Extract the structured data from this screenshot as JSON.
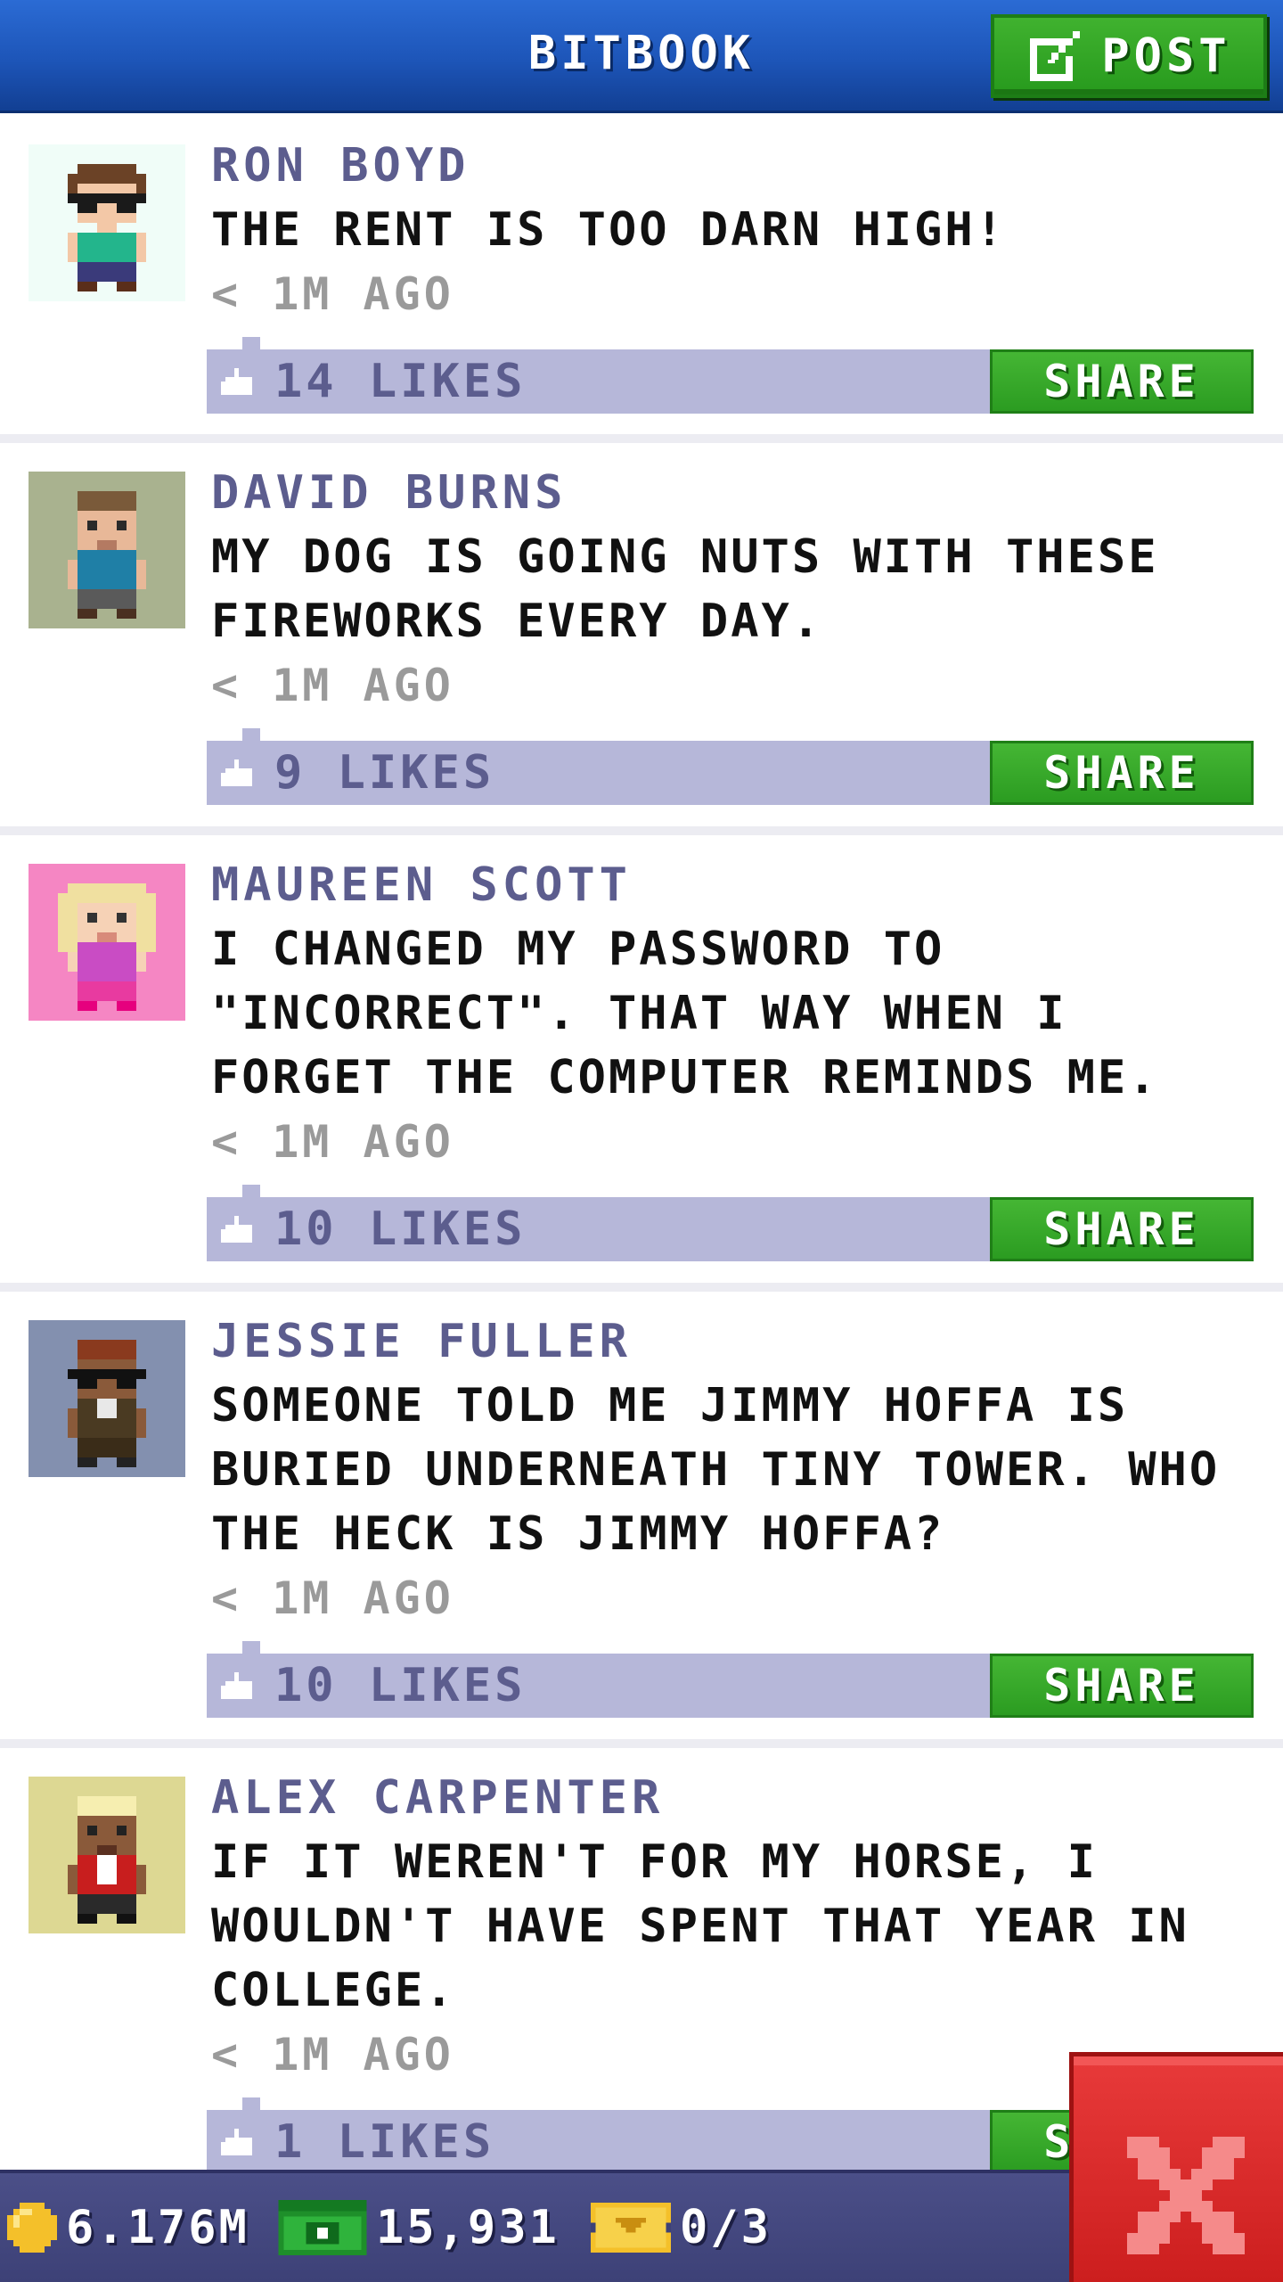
{
  "header": {
    "title": "BITBOOK",
    "post_label": "POST",
    "post_icon": "compose-icon"
  },
  "posts": [
    {
      "name": "RON BOYD",
      "lines": [
        "THE RENT IS TOO DARN HIGH!"
      ],
      "time": "< 1M AGO",
      "likes": "14 LIKES",
      "share": "SHARE",
      "avatar_bg": "#f0fdf8",
      "avatar": "ron-boyd-avatar"
    },
    {
      "name": "DAVID BURNS",
      "lines": [
        "MY DOG IS GOING NUTS WITH THESE",
        "FIREWORKS EVERY DAY."
      ],
      "time": "< 1M AGO",
      "likes": "9 LIKES",
      "share": "SHARE",
      "avatar_bg": "#a9b28f",
      "avatar": "david-burns-avatar"
    },
    {
      "name": "MAUREEN SCOTT",
      "lines": [
        "I CHANGED MY PASSWORD TO",
        "\"INCORRECT\". THAT WAY WHEN I",
        "FORGET THE COMPUTER REMINDS ME."
      ],
      "time": "< 1M AGO",
      "likes": "10 LIKES",
      "share": "SHARE",
      "avatar_bg": "#f586c3",
      "avatar": "maureen-scott-avatar"
    },
    {
      "name": "JESSIE FULLER",
      "lines": [
        "SOMEONE TOLD ME JIMMY HOFFA IS",
        "BURIED UNDERNEATH TINY TOWER. WHO",
        "THE HECK IS JIMMY HOFFA?"
      ],
      "time": "< 1M AGO",
      "likes": "10 LIKES",
      "share": "SHARE",
      "avatar_bg": "#8390af",
      "avatar": "jessie-fuller-avatar"
    },
    {
      "name": "ALEX CARPENTER",
      "lines": [
        "IF IT WEREN'T FOR MY HORSE, I",
        "WOULDN'T HAVE SPENT THAT YEAR IN",
        "COLLEGE."
      ],
      "time": "< 1M AGO",
      "likes": "1 LIKES",
      "share": "SHARE",
      "avatar_bg": "#ddd893",
      "avatar": "alex-carpenter-avatar"
    }
  ],
  "status": {
    "coins": "6.176M",
    "bux": "15,931",
    "tickets": "0/3"
  },
  "close_icon": "close-icon",
  "colors": {
    "header_blue": "#1d55b8",
    "accent_green": "#2b9c21",
    "likes_bar": "#b6b7d9",
    "name_purple": "#5c5d8e",
    "close_red": "#cc1e1e"
  }
}
